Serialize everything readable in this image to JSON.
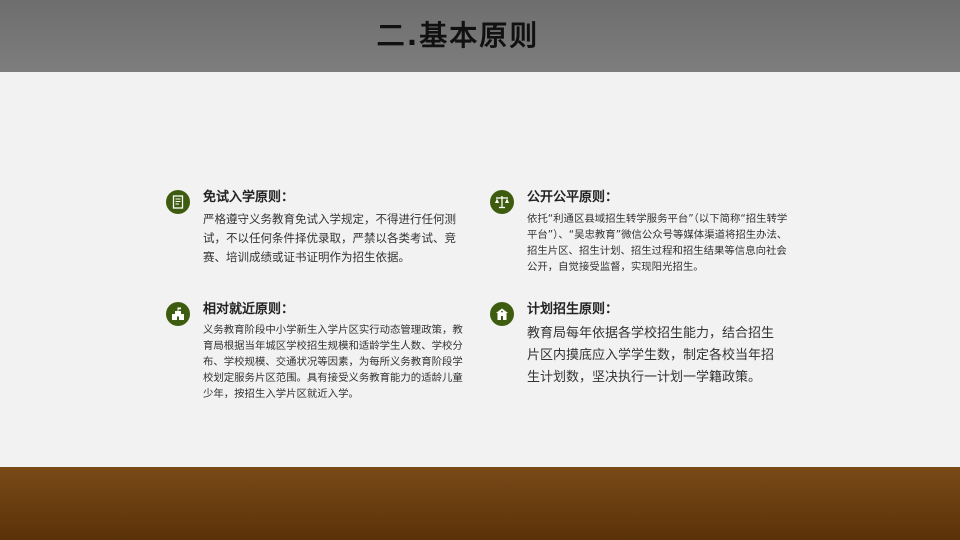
{
  "slide": {
    "title": "二.基本原则"
  },
  "principles": [
    {
      "icon": "document-icon",
      "title": "免试入学原则：",
      "body": "严格遵守义务教育免试入学规定，不得进行任何测试，不以任何条件择优录取，严禁以各类考试、竞赛、培训成绩或证书证明作为招生依据。"
    },
    {
      "icon": "scales-icon",
      "title": "公开公平原则：",
      "body": "依托“利通区县域招生转学服务平台”（以下简称“招生转学平台”）、“吴忠教育”微信公众号等媒体渠道将招生办法、招生片区、招生计划、招生过程和招生结果等信息向社会公开，自觉接受监督，实现阳光招生。"
    },
    {
      "icon": "school-building-icon",
      "title": "相对就近原则：",
      "body": "义务教育阶段中小学新生入学片区实行动态管理政策，教育局根据当年城区学校招生规模和适龄学生人数、学校分布、学校规模、交通状况等因素，为每所义务教育阶段学校划定服务片区范围。具有接受义务教育能力的适龄儿童少年，按招生入学片区就近入学。"
    },
    {
      "icon": "school-house-icon",
      "title": "计划招生原则：",
      "body": "教育局每年依据各学校招生能力，结合招生片区内摸底应入学学生数，制定各校当年招生计划数，坚决执行一计划一学籍政策。"
    }
  ],
  "colors": {
    "header": "#777777",
    "background": "#f2f2f2",
    "footer": "#6b3c10",
    "icon_circle": "#3d5c0f"
  }
}
